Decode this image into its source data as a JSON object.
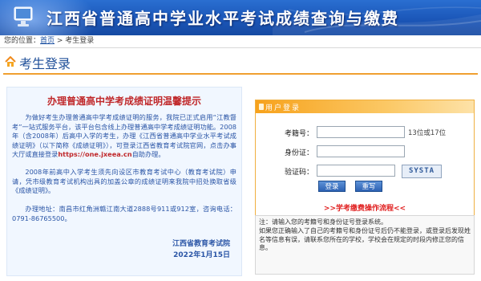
{
  "banner": {
    "title": "江西省普通高中学业水平考试成绩查询与缴费",
    "colors": {
      "bg_top": "#2a6fd1",
      "bg_bottom": "#164aa2",
      "text": "#ffffff"
    }
  },
  "breadcrumb": {
    "prefix": "您的位置：",
    "home": "首页",
    "separator": " > ",
    "current": "考生登录"
  },
  "page_title": {
    "text": "考生登录",
    "icon": "house-arrow-icon",
    "accent": "#f0a030"
  },
  "notice": {
    "heading": "办理普通高中学考成绩证明温馨提示",
    "p1_pre": "为做好考生办理普通高中学考成绩证明的服务，我院已正式启用“江教督考”一站式服务平台，该平台包含线上办理普通高中学考成绩证明功能。2008年（含2008年）后高中入学的考生，办理《江西省普通高中学业水平考试成绩证明》（以下简称《成绩证明》），可登录江西省教育考试院官网，点击办事大厅或直接登录",
    "p1_link": "https://one.jxeea.cn",
    "p1_post": "自助办理。",
    "p2": "2008年前高中入学考生须先向设区市教育考试中心（教育考试院）申请，凭市级教育考试机构出具的加盖公章的成绩证明来我院中招处换取省级《成绩证明》。",
    "p3": "办理地址：南昌市红角洲赣江南大道2888号911或912室，咨询电话：0791-86765500。",
    "org": "江西省教育考试院",
    "date": "2022年1月15日"
  },
  "login": {
    "header": "用户登录",
    "exam_no_label": "考籍号：",
    "exam_no_value": "",
    "exam_no_hint": "13位或17位",
    "id_label": "身份证：",
    "id_value": "",
    "code_label": "验证码：",
    "code_value": "",
    "captcha_text": "SYSTA",
    "login_button": "登录",
    "reset_button": "重写",
    "process_link": ">>学考缴费操作流程<<"
  },
  "note": {
    "line1": "注：请输入您的考籍号和身份证号登录系统。",
    "line2": "如果您正确输入了自己的考籍号和身份证号后仍不能登录，或登录后发现姓名等信息有误，请联系您所在的学校，学校会在规定的时段内修正您的信息。"
  }
}
